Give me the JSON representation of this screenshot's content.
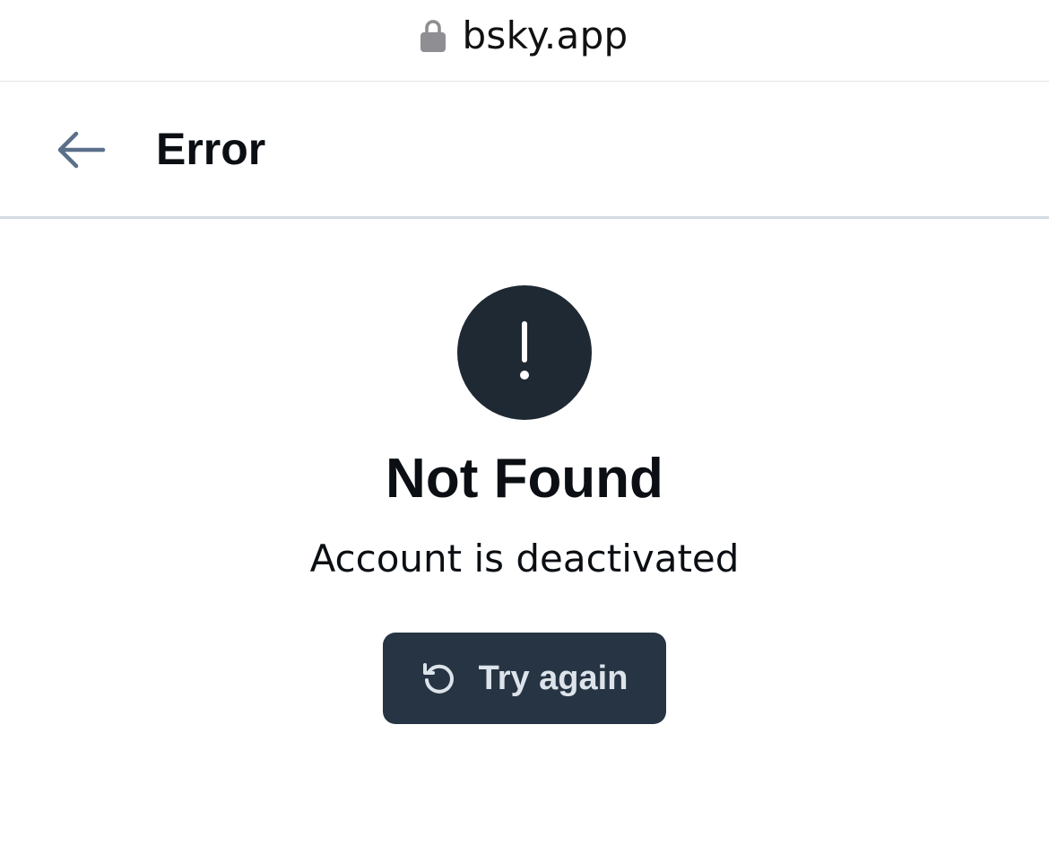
{
  "browser": {
    "url": "bsky.app",
    "lock_icon": "lock-icon"
  },
  "header": {
    "back_icon": "arrow-left-icon",
    "title": "Error"
  },
  "error": {
    "icon": "exclamation-circle-icon",
    "title": "Not Found",
    "message": "Account is deactivated",
    "retry_icon": "rotate-ccw-icon",
    "retry_label": "Try again"
  },
  "colors": {
    "header_divider": "#d4dbe2",
    "alert_circle": "#1f2933",
    "button_background": "#263443",
    "button_text": "#dde3ea",
    "back_arrow": "#5b6f8a"
  }
}
